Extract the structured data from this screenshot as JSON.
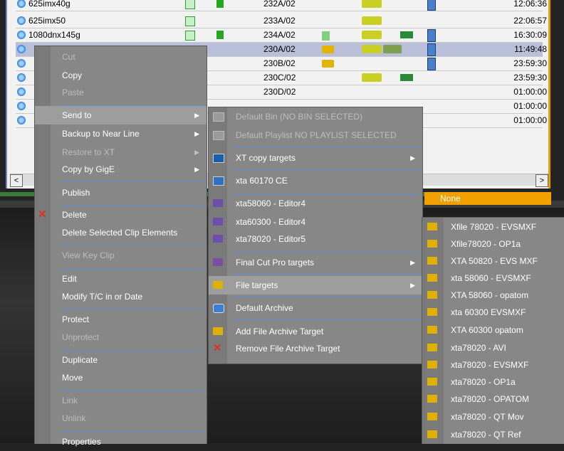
{
  "list": {
    "rows": [
      {
        "name": "625imx40g",
        "id": "232A/02",
        "time": "12:06:36"
      },
      {
        "name": "625imx50",
        "id": "233A/02",
        "time": "22:06:57"
      },
      {
        "name": "1080dnx145g",
        "id": "234A/02",
        "time": "16:30:09"
      },
      {
        "name": "",
        "id": "230A/02",
        "time": "11:49:48"
      },
      {
        "name": "",
        "id": "230B/02",
        "time": "23:59:30"
      },
      {
        "name": "",
        "id": "230C/02",
        "time": "23:59:30"
      },
      {
        "name": "",
        "id": "230D/02",
        "time": "01:00:00"
      },
      {
        "name": "",
        "id": "",
        "time": "01:00:00"
      },
      {
        "name": "",
        "id": "",
        "time": "01:00:00"
      }
    ],
    "scroll_left": "<",
    "scroll_right": ">",
    "status_text": "None"
  },
  "context_menu": {
    "items": [
      {
        "label": "Cut",
        "disabled": true
      },
      {
        "label": "Copy",
        "disabled": false
      },
      {
        "label": "Paste",
        "disabled": true
      },
      {
        "label": "Send to",
        "disabled": false
      },
      {
        "label": "Backup to Near Line",
        "disabled": false
      },
      {
        "label": "Restore to XT",
        "disabled": true
      },
      {
        "label": "Copy by GigE",
        "disabled": false
      },
      {
        "label": "Publish",
        "disabled": false
      },
      {
        "label": "Delete",
        "disabled": false
      },
      {
        "label": "Delete Selected Clip Elements",
        "disabled": false
      },
      {
        "label": "View Key Clip",
        "disabled": true
      },
      {
        "label": "Edit",
        "disabled": false
      },
      {
        "label": "Modify T/C in or Date",
        "disabled": false
      },
      {
        "label": "Protect",
        "disabled": false
      },
      {
        "label": "Unprotect",
        "disabled": true
      },
      {
        "label": "Duplicate",
        "disabled": false
      },
      {
        "label": "Move",
        "disabled": false
      },
      {
        "label": "Link",
        "disabled": true
      },
      {
        "label": "Unlink",
        "disabled": true
      },
      {
        "label": "Properties",
        "disabled": false
      }
    ]
  },
  "sendto_menu": {
    "items": [
      {
        "label": "Default Bin (NO BIN SELECTED)",
        "icon": "bin-icon",
        "disabled": true
      },
      {
        "label": "Default Playlist NO PLAYLIST SELECTED",
        "icon": "playlist-icon",
        "disabled": true
      },
      {
        "label": "XT copy targets",
        "icon": "xt-icon",
        "disabled": false
      },
      {
        "label": "xta 60170 CE",
        "icon": "ce-icon",
        "disabled": false
      },
      {
        "label": "xta58060 - Editor4",
        "icon": "avid-icon",
        "disabled": false
      },
      {
        "label": "xta60300 - Editor4",
        "icon": "avid-icon",
        "disabled": false
      },
      {
        "label": "xta78020 - Editor5",
        "icon": "avid-icon",
        "disabled": false
      },
      {
        "label": "Final Cut Pro targets",
        "icon": "fcp-icon",
        "disabled": false
      },
      {
        "label": "File targets",
        "icon": "folder-icon",
        "disabled": false
      },
      {
        "label": "Default Archive",
        "icon": "archive-icon",
        "disabled": false
      },
      {
        "label": "Add File Archive Target",
        "icon": "folder-icon",
        "disabled": false
      },
      {
        "label": "Remove File Archive Target",
        "icon": "remove-icon",
        "disabled": false
      }
    ]
  },
  "file_targets_menu": {
    "items": [
      {
        "label": "Xfile 78020 - EVSMXF"
      },
      {
        "label": "Xfile78020 - OP1a"
      },
      {
        "label": "XTA 50820 - EVS MXF"
      },
      {
        "label": "xta 58060 - EVSMXF"
      },
      {
        "label": "XTA 58060 - opatom"
      },
      {
        "label": "xta 60300 EVSMXF"
      },
      {
        "label": "XTA 60300 opatom"
      },
      {
        "label": "xta78020 - AVI"
      },
      {
        "label": "xta78020 - EVSMXF"
      },
      {
        "label": "xta78020 - OP1a"
      },
      {
        "label": "xta78020 - OPATOM"
      },
      {
        "label": "xta78020 - QT Mov"
      },
      {
        "label": "xta78020 - QT Ref"
      }
    ]
  },
  "colors": {
    "accent": "#5b8fd0",
    "menu_bg": "#878787",
    "highlight": "#9d9d9d",
    "warning": "#f0a000"
  }
}
